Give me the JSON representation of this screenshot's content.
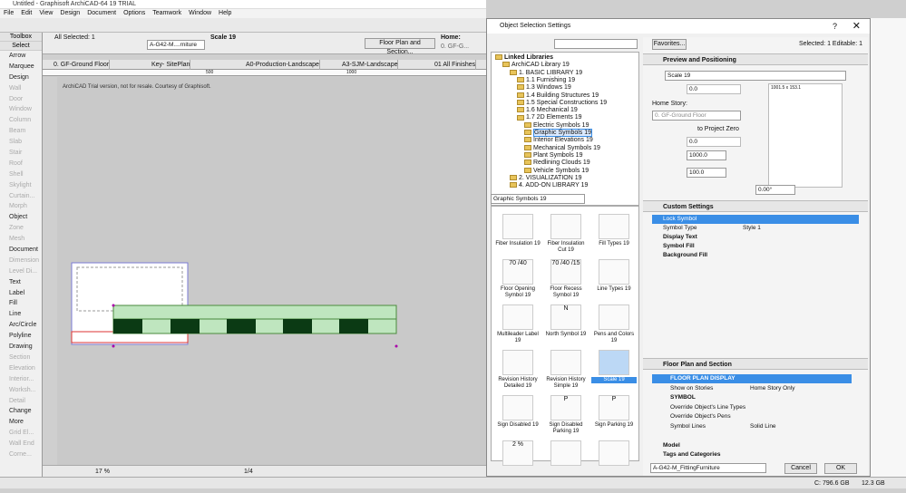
{
  "app": {
    "title": "Untitled - Graphisoft ArchiCAD-64 19 TRIAL",
    "menu": [
      "File",
      "Edit",
      "View",
      "Design",
      "Document",
      "Options",
      "Teamwork",
      "Window",
      "Help"
    ]
  },
  "toolbox": {
    "header": "Toolbox",
    "select_label": "Select",
    "items": [
      {
        "label": "Arrow",
        "dim": false
      },
      {
        "label": "Marquee",
        "dim": false
      },
      {
        "label": "Design",
        "dim": false
      },
      {
        "label": "Wall",
        "dim": true
      },
      {
        "label": "Door",
        "dim": true
      },
      {
        "label": "Window",
        "dim": true
      },
      {
        "label": "Column",
        "dim": true
      },
      {
        "label": "Beam",
        "dim": true
      },
      {
        "label": "Slab",
        "dim": true
      },
      {
        "label": "Stair",
        "dim": true
      },
      {
        "label": "Roof",
        "dim": true
      },
      {
        "label": "Shell",
        "dim": true
      },
      {
        "label": "Skylight",
        "dim": true
      },
      {
        "label": "Curtain...",
        "dim": true
      },
      {
        "label": "Morph",
        "dim": true
      },
      {
        "label": "Object",
        "dim": false
      },
      {
        "label": "Zone",
        "dim": true
      },
      {
        "label": "Mesh",
        "dim": true
      },
      {
        "label": "Document",
        "dim": false
      },
      {
        "label": "Dimension",
        "dim": true
      },
      {
        "label": "Level Di...",
        "dim": true
      },
      {
        "label": "Text",
        "dim": false
      },
      {
        "label": "Label",
        "dim": false
      },
      {
        "label": "Fill",
        "dim": false
      },
      {
        "label": "Line",
        "dim": false
      },
      {
        "label": "Arc/Circle",
        "dim": false
      },
      {
        "label": "Polyline",
        "dim": false
      },
      {
        "label": "Drawing",
        "dim": false
      },
      {
        "label": "Section",
        "dim": true
      },
      {
        "label": "Elevation",
        "dim": true
      },
      {
        "label": "Interior...",
        "dim": true
      },
      {
        "label": "Worksh...",
        "dim": true
      },
      {
        "label": "Detail",
        "dim": true
      },
      {
        "label": "Change",
        "dim": false
      },
      {
        "label": "More",
        "dim": false
      },
      {
        "label": "Grid El...",
        "dim": true
      },
      {
        "label": "Wall End",
        "dim": true
      },
      {
        "label": "Corne...",
        "dim": true
      }
    ]
  },
  "infobox": {
    "all_selected": "All Selected: 1",
    "layer": "A-G42-M....rniture",
    "scale_label": "Scale 19",
    "floor_plan_btn": "Floor Plan and Section...",
    "home_label": "Home:",
    "home_value": "0. GF-G..."
  },
  "tabs": [
    "0. GF-Ground Floor",
    "Key- SitePlan",
    "A0-Production-Landscape",
    "A3-SJM-Landscape",
    "01 All Finishes"
  ],
  "ruler": [
    "500",
    "1000",
    "500"
  ],
  "canvas_note": "ArchiCAD Trial version, not for resale. Courtesy of Graphisoft.",
  "status": {
    "zoom": "17 %",
    "page": "1/4",
    "disk": "C: 796.6 GB",
    "mem": "12.3 GB"
  },
  "dialog": {
    "title": "Object Selection Settings",
    "favorites": "Favorites...",
    "selected_info": "Selected: 1 Editable: 1",
    "tree": [
      {
        "label": "Linked Libraries",
        "indent": 0,
        "bold": true
      },
      {
        "label": "ArchiCAD Library 19",
        "indent": 1
      },
      {
        "label": "1. BASIC LIBRARY 19",
        "indent": 2
      },
      {
        "label": "1.1 Furnishing 19",
        "indent": 3
      },
      {
        "label": "1.3 Windows 19",
        "indent": 3
      },
      {
        "label": "1.4 Building Structures 19",
        "indent": 3
      },
      {
        "label": "1.5 Special Constructions 19",
        "indent": 3
      },
      {
        "label": "1.6 Mechanical 19",
        "indent": 3
      },
      {
        "label": "1.7 2D Elements 19",
        "indent": 3
      },
      {
        "label": "Electric Symbols 19",
        "indent": 4
      },
      {
        "label": "Graphic Symbols 19",
        "indent": 4,
        "selected": true
      },
      {
        "label": "Interior Elevations 19",
        "indent": 4
      },
      {
        "label": "Mechanical Symbols 19",
        "indent": 4
      },
      {
        "label": "Plant Symbols 19",
        "indent": 4
      },
      {
        "label": "Redlining Clouds 19",
        "indent": 4
      },
      {
        "label": "Vehicle Symbols 19",
        "indent": 4
      },
      {
        "label": "2. VISUALIZATION 19",
        "indent": 2
      },
      {
        "label": "4. ADD-ON LIBRARY 19",
        "indent": 2
      }
    ],
    "folder_select": "Graphic Symbols 19",
    "gallery": [
      {
        "label": "Fiber Insulation 19"
      },
      {
        "label": "Fiber Insulation Cut 19"
      },
      {
        "label": "Fill Types 19"
      },
      {
        "label": "Floor Opening Symbol 19",
        "thumb_text": "70 /40"
      },
      {
        "label": "Floor Recess Symbol 19",
        "thumb_text": "70 /40 /15"
      },
      {
        "label": "Line Types 19"
      },
      {
        "label": "Multileader Label 19"
      },
      {
        "label": "North Symbol 19",
        "thumb_text": "N"
      },
      {
        "label": "Pens and Colors 19"
      },
      {
        "label": "Revision History Detailed 19"
      },
      {
        "label": "Revision History Simple 19"
      },
      {
        "label": "Scale 19",
        "selected": true
      },
      {
        "label": "Sign Disabled 19"
      },
      {
        "label": "Sign Disabled Parking 19",
        "thumb_text": "P"
      },
      {
        "label": "Sign Parking 19",
        "thumb_text": "P"
      },
      {
        "label": "",
        "thumb_text": "2 %"
      },
      {
        "label": ""
      },
      {
        "label": ""
      }
    ],
    "preview": {
      "header": "Preview and Positioning",
      "name_field": "Scale 19",
      "elev_value": "0.0",
      "home_story_label": "Home Story:",
      "home_story_value": "0. GF-Ground Floor",
      "to_project_zero": "to Project Zero",
      "elev2": "0.0",
      "dim_a": "1000.0",
      "dim_b": "100.0",
      "preview_caption": "1001.5 x 153.1",
      "angle": "0.00°"
    },
    "custom": {
      "header": "Custom Settings",
      "rows": [
        {
          "label": "Lock Symbol",
          "value": "",
          "selected": true
        },
        {
          "label": "Symbol Type",
          "value": "Style 1"
        },
        {
          "label": "Display Text",
          "value": "",
          "bold": true
        },
        {
          "label": "Symbol Fill",
          "value": "",
          "bold": true
        },
        {
          "label": "Background Fill",
          "value": "",
          "bold": true
        }
      ]
    },
    "floorplan": {
      "header": "Floor Plan and Section",
      "rows": [
        {
          "label": "FLOOR PLAN DISPLAY",
          "value": "",
          "selected": true
        },
        {
          "label": "Show on Stories",
          "value": "Home Story Only"
        },
        {
          "label": "SYMBOL",
          "value": "",
          "bold": true
        },
        {
          "label": "Override Object's Line Types",
          "value": ""
        },
        {
          "label": "Override Object's Pens",
          "value": ""
        },
        {
          "label": "Symbol Lines",
          "value": "Solid Line"
        }
      ]
    },
    "collapsed_sections": [
      "Model",
      "Tags and Categories"
    ],
    "layer_field": "A-G42-M_FittingFurniture",
    "cancel": "Cancel",
    "ok": "OK"
  },
  "colors": {
    "select_blue": "#3a8ee6",
    "green_fill": "#bfe6bf",
    "green_stroke": "#4a8a3c",
    "dark_green": "#0b3a14"
  }
}
